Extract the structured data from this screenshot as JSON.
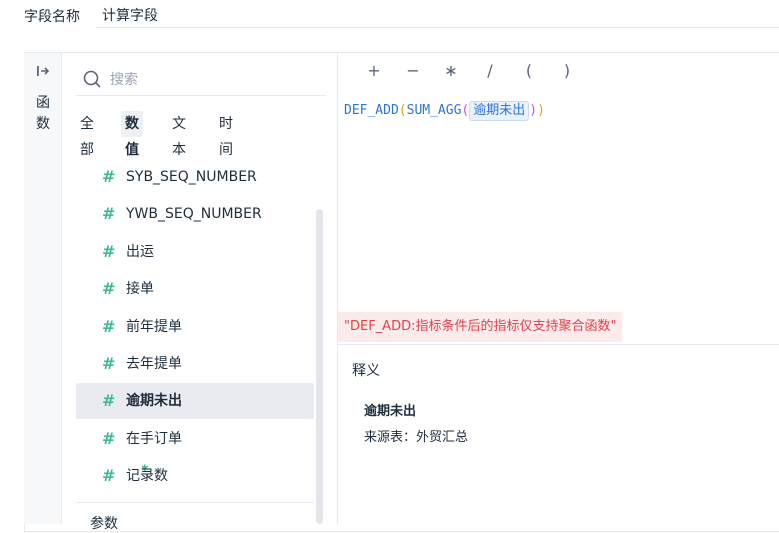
{
  "field": {
    "label": "字段名称",
    "value": "计算字段"
  },
  "rail": {
    "toggle_icon": "expand-right-icon",
    "label": "函数"
  },
  "sidebar": {
    "search_placeholder": "搜索",
    "tabs": [
      {
        "label": "全部",
        "active": false
      },
      {
        "label": "数值",
        "active": true
      },
      {
        "label": "文本",
        "active": false
      },
      {
        "label": "时间",
        "active": false
      }
    ],
    "items": [
      {
        "icon": "hash-icon",
        "label": "SYB_SEQ_NUMBER",
        "active": false
      },
      {
        "icon": "hash-icon",
        "label": "YWB_SEQ_NUMBER",
        "active": false
      },
      {
        "icon": "hash-icon",
        "label": "出运",
        "active": false
      },
      {
        "icon": "hash-icon",
        "label": "接单",
        "active": false
      },
      {
        "icon": "hash-icon",
        "label": "前年提单",
        "active": false
      },
      {
        "icon": "hash-icon",
        "label": "去年提单",
        "active": false
      },
      {
        "icon": "hash-icon",
        "label": "逾期未出",
        "active": true
      },
      {
        "icon": "hash-icon",
        "label": "在手订单",
        "active": false
      },
      {
        "icon": "hash-star-icon",
        "label": "记录数",
        "active": false
      }
    ],
    "next_group": "参数"
  },
  "operators": [
    "+",
    "−",
    "∗",
    "/",
    "(",
    ")"
  ],
  "formula": {
    "outer_fn": "DEF_ADD",
    "inner_fn": "SUM_AGG",
    "open": "(",
    "close": ")",
    "field": "逾期未出"
  },
  "error_message": "\"DEF_ADD:指标条件后的指标仅支持聚合函数\"",
  "description": {
    "title": "释义",
    "name": "逾期未出",
    "source": "来源表：外贸汇总"
  },
  "colors": {
    "accent": "#2f73d9",
    "number_field": "#3fb89a",
    "error": "#e0414b"
  }
}
